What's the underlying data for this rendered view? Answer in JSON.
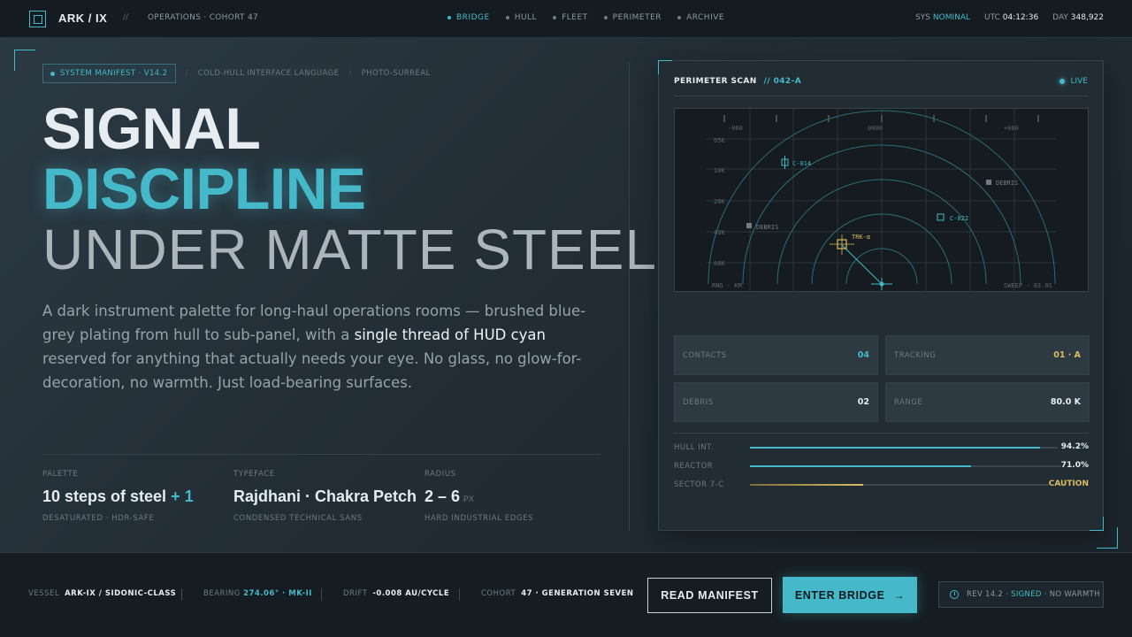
{
  "header": {
    "brand": "ARK / IX",
    "separator": "//",
    "subtitle": "OPERATIONS · COHORT 47",
    "nav": [
      {
        "label": "BRIDGE",
        "active": true
      },
      {
        "label": "HULL",
        "active": false
      },
      {
        "label": "FLEET",
        "active": false
      },
      {
        "label": "PERIMETER",
        "active": false
      },
      {
        "label": "ARCHIVE",
        "active": false
      }
    ],
    "sys_label": "SYS",
    "sys_value": "NOMINAL",
    "utc_label": "UTC",
    "utc_value": "04:12:36",
    "day_label": "DAY",
    "day_value": "348,922"
  },
  "hero": {
    "chip_primary": "SYSTEM MANIFEST · V14.2",
    "chip_sep": "/",
    "chip_2": "COLD-HULL INTERFACE LANGUAGE",
    "chip_3": "PHOTO-SURREAL",
    "line1": "SIGNAL",
    "line2": "DISCIPLINE",
    "line3": "UNDER MATTE STEEL.",
    "lede_before": "A dark instrument palette for long-haul operations rooms — brushed blue-grey plating from hull to sub-panel, with a ",
    "lede_highlight": "single thread of HUD cyan",
    "lede_after": " reserved for anything that actually needs your eye. No glass, no glow-for-decoration, no warmth. Just load-bearing surfaces."
  },
  "specs": [
    {
      "key": "PALETTE",
      "value": "10 steps of steel",
      "accent": "+ 1",
      "unit": "",
      "sub": "DESATURATED · HDR-SAFE"
    },
    {
      "key": "TYPEFACE",
      "value": "Rajdhani · Chakra Petch",
      "accent": "",
      "unit": "",
      "sub": "CONDENSED TECHNICAL SANS"
    },
    {
      "key": "RADIUS",
      "value": "2 – 6",
      "accent": "",
      "unit": "PX",
      "sub": "HARD INDUSTRIAL EDGES"
    }
  ],
  "panel": {
    "title": "PERIMETER SCAN",
    "id": "// 042-A",
    "live": "LIVE",
    "scan": {
      "bearings": [
        "-060",
        "0000",
        "+060"
      ],
      "ranges": [
        "05K",
        "10K",
        "20K",
        "40K",
        "80K"
      ],
      "contacts": [
        {
          "label": "C-014",
          "kind": "contact"
        },
        {
          "label": "DEBRIS",
          "kind": "debris"
        },
        {
          "label": "C-022",
          "kind": "contact"
        },
        {
          "label": "DEBRIS",
          "kind": "debris"
        },
        {
          "label": "TRK-α",
          "kind": "track"
        }
      ],
      "footer_left": "RNG · KM",
      "footer_right": "SWEEP · 03.0S"
    },
    "stats": [
      {
        "key": "CONTACTS",
        "value": "04",
        "tone": "cyan"
      },
      {
        "key": "TRACKING",
        "value": "01 · A",
        "tone": "gold"
      },
      {
        "key": "DEBRIS",
        "value": "02",
        "tone": "white"
      },
      {
        "key": "RANGE",
        "value": "80.0 K",
        "tone": "white"
      }
    ],
    "meters": [
      {
        "key": "HULL INT.",
        "value": "94.2%",
        "level": 0.942,
        "tone": "cyan"
      },
      {
        "key": "REACTOR",
        "value": "71.0%",
        "level": 0.71,
        "tone": "cyan"
      },
      {
        "key": "SECTOR 7-C",
        "value": "CAUTION",
        "level": 0.38,
        "tone": "gold"
      }
    ]
  },
  "footer": {
    "vessel_label": "VESSEL",
    "vessel_value": "ARK-IX / SIDONIC-CLASS",
    "bearing_label": "BEARING",
    "bearing_value": "274.06° · MK-II",
    "drift_label": "DRIFT",
    "drift_value": "-0.008 AU/CYCLE",
    "cohort_label": "COHORT",
    "cohort_value": "47 · GENERATION SEVEN",
    "read_manifest": "READ MANIFEST",
    "enter_bridge": "ENTER BRIDGE",
    "enter_arrow": "→",
    "rev_prefix": "REV 14.2 ·",
    "rev_signed": "SIGNED",
    "rev_suffix": "· NO WARMTH"
  },
  "colors": {
    "accent": "#45b9c9",
    "caution": "#d8bd62",
    "steel_bg": "#222d35",
    "text": "#e6ecef"
  }
}
